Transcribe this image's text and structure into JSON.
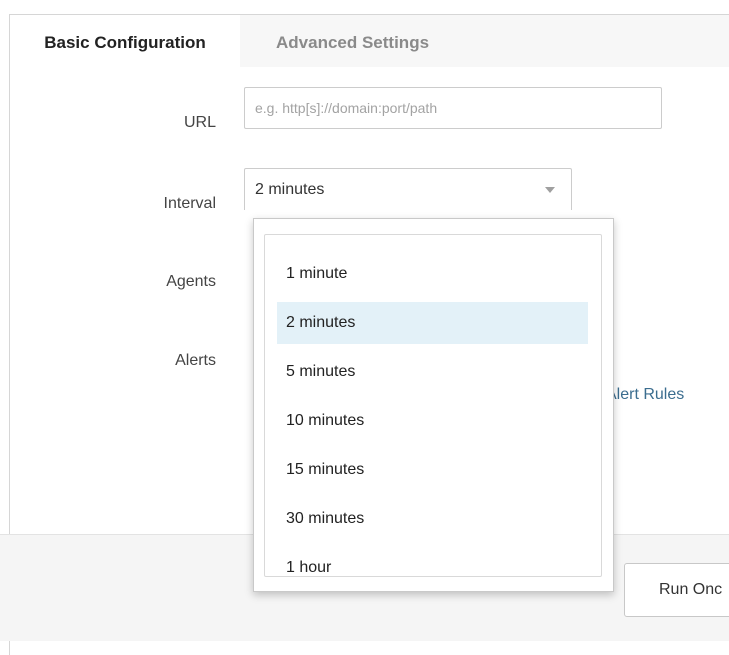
{
  "tabs": [
    {
      "label": "Basic Configuration",
      "active": true
    },
    {
      "label": "Advanced Settings",
      "active": false
    }
  ],
  "form": {
    "url": {
      "label": "URL",
      "value": "",
      "placeholder": "e.g. http[s]://domain:port/path"
    },
    "interval": {
      "label": "Interval",
      "selected": "2 minutes"
    },
    "agents": {
      "label": "Agents"
    },
    "alerts": {
      "label": "Alerts",
      "link_partial": "t Alert Rules"
    }
  },
  "dropdown": {
    "options": [
      "1 minute",
      "2 minutes",
      "5 minutes",
      "10 minutes",
      "15 minutes",
      "30 minutes",
      "1 hour"
    ],
    "selected_index": 1
  },
  "footer": {
    "run_button_partial": "Run Onc"
  },
  "colors": {
    "selected_option_bg": "#e3f1f8",
    "link": "#3b6d8f",
    "tab_bar_bg": "#f7f7f7"
  }
}
